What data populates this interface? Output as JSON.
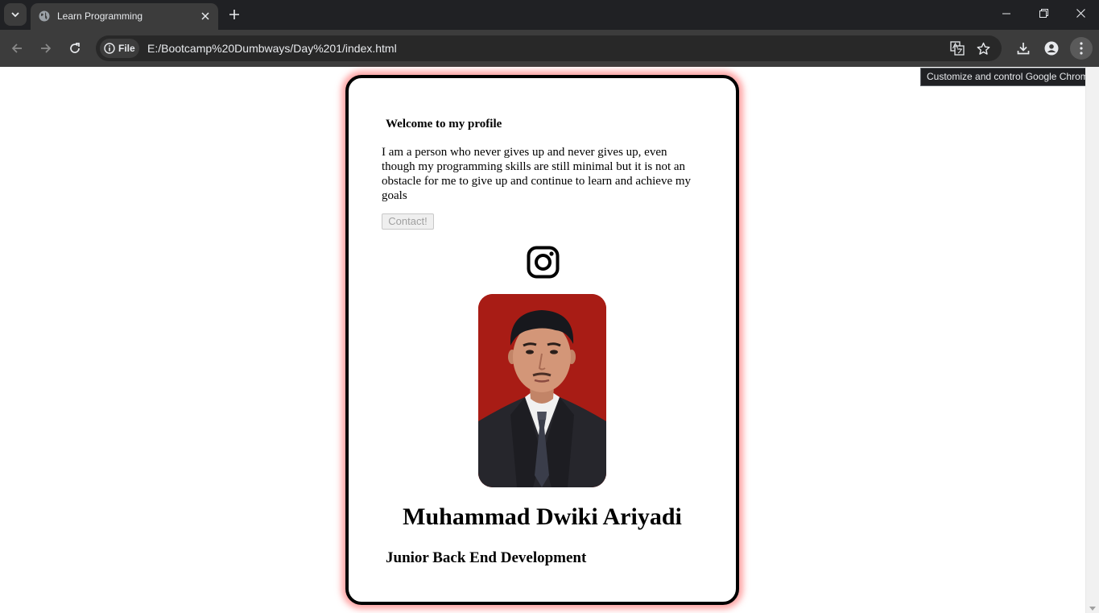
{
  "browser": {
    "tab_title": "Learn Programming",
    "site_chip_label": "File",
    "url": "E:/Bootcamp%20Dumbways/Day%201/index.html",
    "tooltip": "Customize and control Google Chrome",
    "icons": [
      "tab-search-icon",
      "globe-icon",
      "close-icon",
      "plus-icon",
      "minimize-icon",
      "restore-icon",
      "close-window-icon",
      "back-icon",
      "forward-icon",
      "reload-icon",
      "info-icon",
      "translate-icon",
      "star-icon",
      "download-icon",
      "profile-icon",
      "kebab-menu-icon"
    ]
  },
  "profile": {
    "welcome": "Welcome to my profile",
    "about": "I am a person who never gives up and never gives up, even though my programming skills are still minimal but it is not an obstacle for me to give up and continue to learn and achieve my goals",
    "contact_label": "Contact!",
    "social_icon": "instagram-icon",
    "name": "Muhammad Dwiki Ariyadi",
    "role": "Junior Back End Development"
  },
  "colors": {
    "card_border": "#000000",
    "card_glow": "#ff5a5a",
    "photo_background": "#a81c15",
    "chrome_dark": "#202124",
    "chrome_toolbar": "#3c3c3c"
  }
}
